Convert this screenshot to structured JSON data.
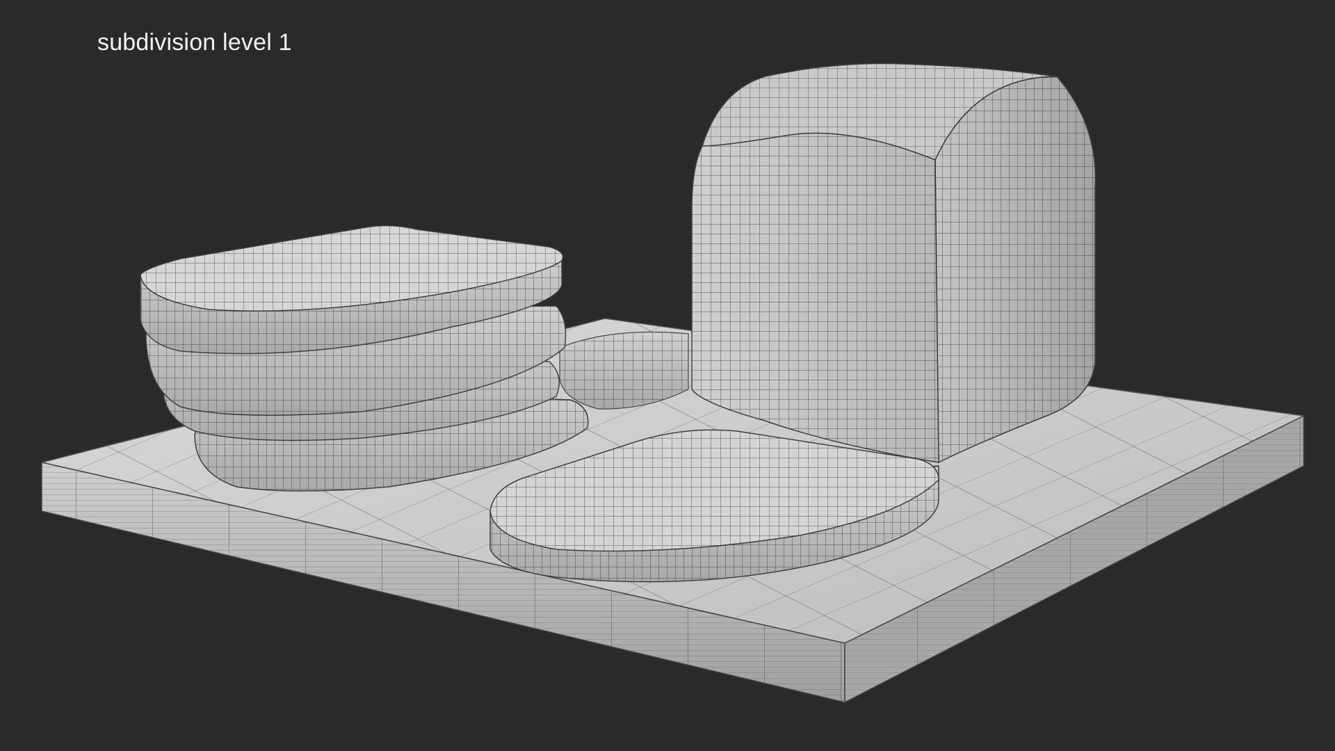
{
  "label": {
    "text": "subdivision level 1"
  },
  "scene": {
    "background_color": "#2a2a2a",
    "mesh_color": "#c8c8c8",
    "wire_color": "#3a3a3a",
    "objects": [
      "cutting-board",
      "bread-slice-stack",
      "bread-loaf",
      "bread-slice-flat",
      "bread-slice-back"
    ]
  }
}
